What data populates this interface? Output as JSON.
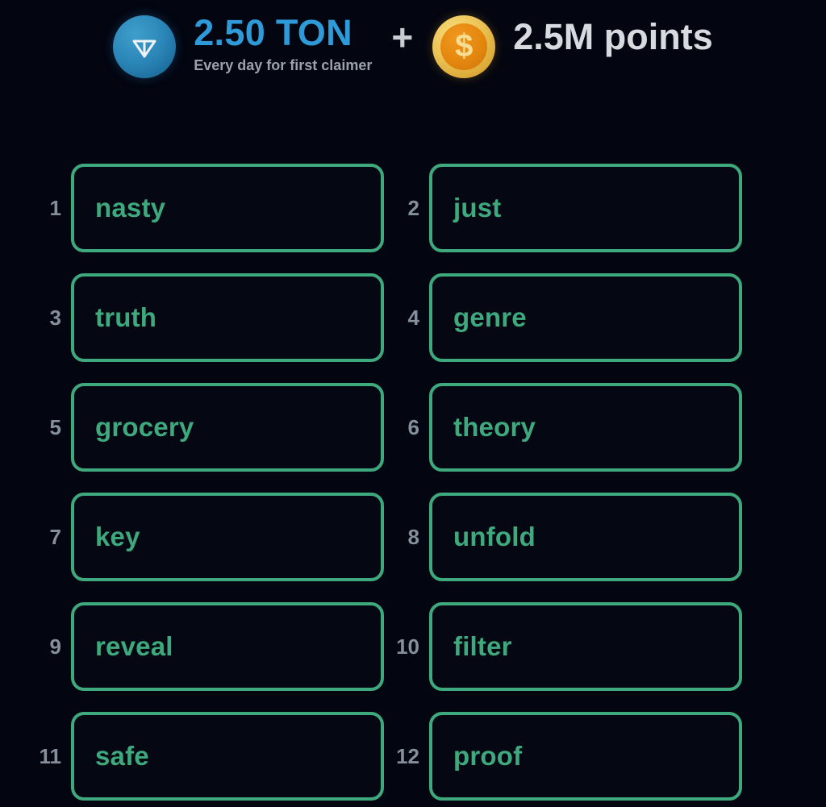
{
  "background_color": "#030510",
  "header": {
    "ton_icon": "ton-diamond-icon",
    "ton_amount": "2.50 TON",
    "ton_amount_color": "#2e9ad8",
    "subtitle": "Every day for first claimer",
    "subtitle_color": "#9ba2ab",
    "plus": "+",
    "coin_icon": "dollar-coin-icon",
    "coin_symbol": "$",
    "points": "2.5M points",
    "points_color": "#d7dade"
  },
  "word_grid": {
    "accent_color": "#3fa97e",
    "index_color": "#868f9c",
    "columns": 2,
    "items": [
      {
        "index": "1",
        "word": "nasty"
      },
      {
        "index": "2",
        "word": "just"
      },
      {
        "index": "3",
        "word": "truth"
      },
      {
        "index": "4",
        "word": "genre"
      },
      {
        "index": "5",
        "word": "grocery"
      },
      {
        "index": "6",
        "word": "theory"
      },
      {
        "index": "7",
        "word": "key"
      },
      {
        "index": "8",
        "word": "unfold"
      },
      {
        "index": "9",
        "word": "reveal"
      },
      {
        "index": "10",
        "word": "filter"
      },
      {
        "index": "11",
        "word": "safe"
      },
      {
        "index": "12",
        "word": "proof"
      }
    ]
  }
}
